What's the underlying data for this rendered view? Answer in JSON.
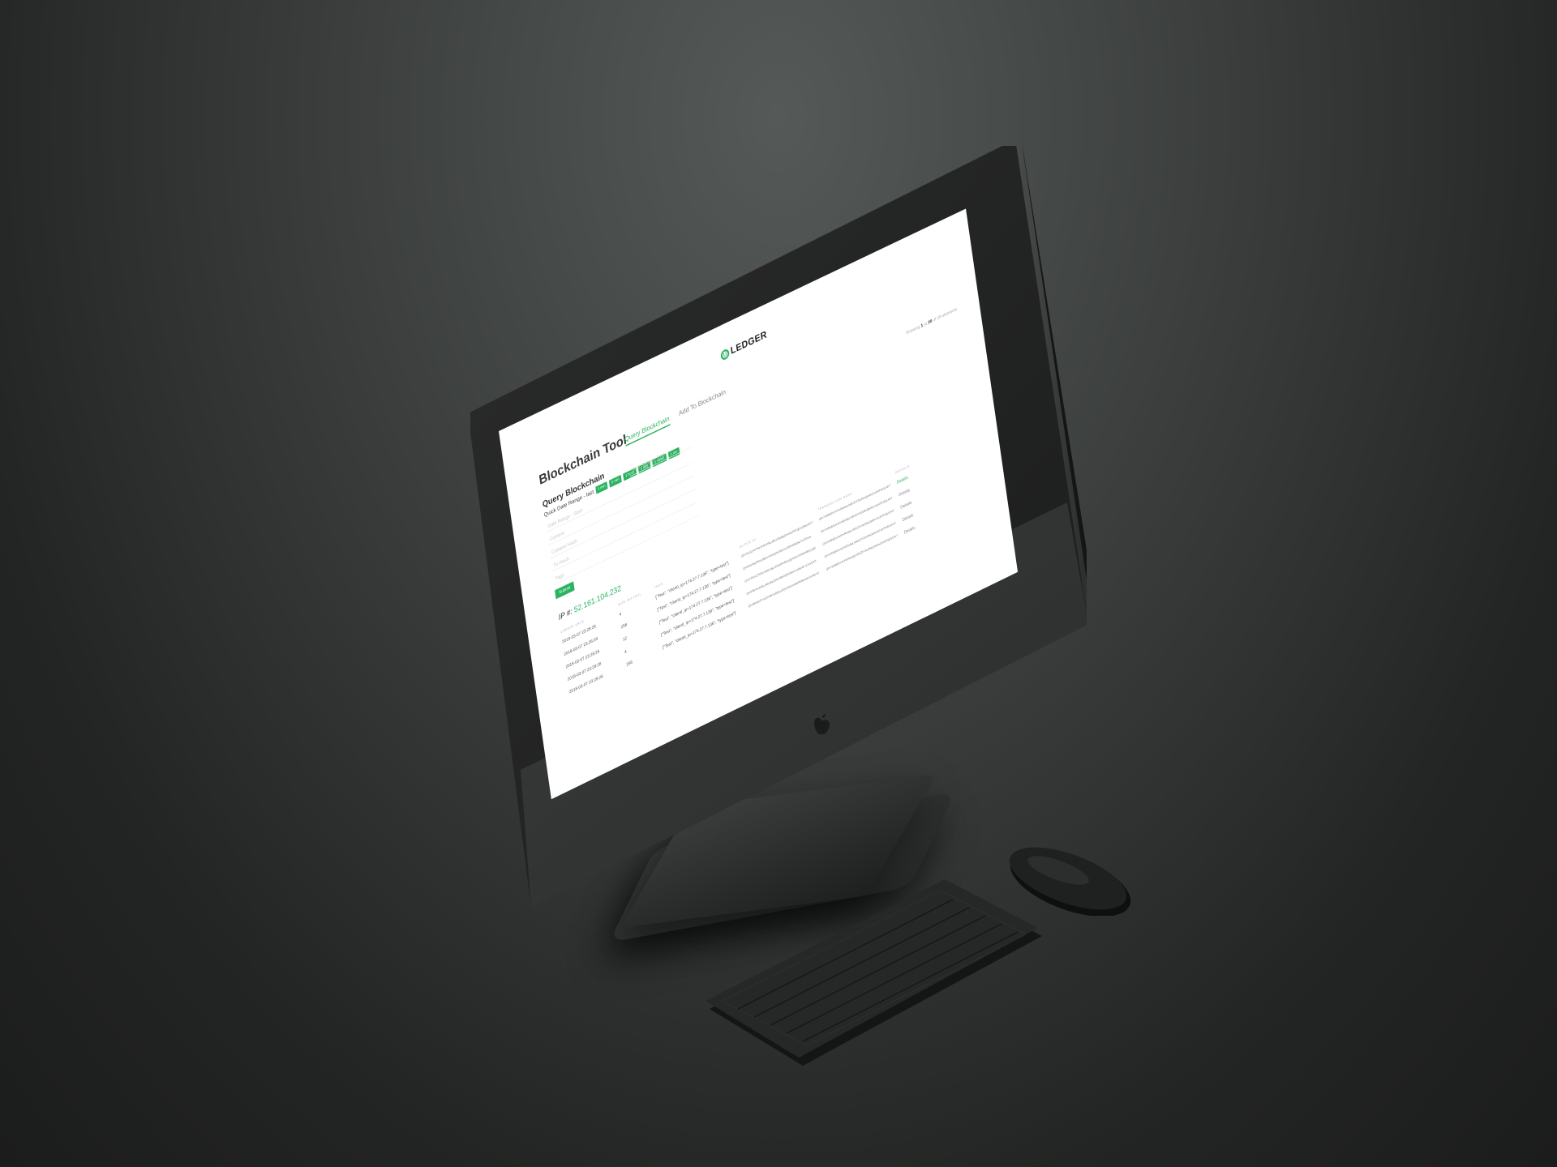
{
  "header": {
    "logo_mark": "U",
    "logo_text": "LEDGER"
  },
  "page": {
    "title": "Blockchain Tool",
    "tabs": [
      {
        "label": "Query Blockchain",
        "active": true
      },
      {
        "label": "Add To Blockchain",
        "active": false
      }
    ]
  },
  "query": {
    "section_title": "Query Blockchain",
    "quick_range_label": "Quick Date Range - last",
    "chips": [
      "1 min",
      "5 min",
      "1 hour",
      "1 day",
      "1 week",
      "1 mo"
    ],
    "fields": {
      "date_start": "Date Range - Start",
      "date_end": "Date Range - End",
      "content": "Content",
      "content_hash": "Content Hash",
      "tx_hash": "Tx Hash",
      "tags": "Tags"
    },
    "submit_label": "Submit"
  },
  "ip": {
    "label": "IP #: ",
    "value": "52.161.104.232"
  },
  "results": {
    "showing_prefix": "Showing ",
    "showing_from": "1",
    "showing_to_sep": " to ",
    "showing_to": "20",
    "showing_suffix": " of 28 elements",
    "columns": [
      "CREATE DATE",
      "SIZE (BYTES)",
      "TAGS",
      "BLOCK ID",
      "TRANSACTION HASH",
      "DETAILS"
    ],
    "rows": [
      {
        "date": "2018-03-07 23:28:26",
        "size": "4",
        "tags": "[\"Test\", \"clientI_ip=174.27.7.136\", \"type=test\"]",
        "block": "QmYkL9zXhT6e2nNvWkLaRcU3pBqDmS4oFhGjE1tZ8aVbY7",
        "hash": "Qm7eNkB2uVxFmRw6pLh8GZtY3cD9sQaWnJ1oKiPxEyU4rT",
        "details": "Details"
      },
      {
        "date": "2018-03-07 23:28:26",
        "size": "256",
        "tags": "[\"Test\", \"clientI_ip=174.27.7.136\", \"type=test\"]",
        "block": "QmR4aWqP8nLdBt2vXhK6jZsE9yGcUf3oMiNp5eTr1lYbVk",
        "hash": "Qm7eNkB2uVxFmRw6pLh8GZtY3cD9sQaWnJ1oKiPxEyU4rT",
        "details": "Details"
      },
      {
        "date": "2018-03-07 23:28:26",
        "size": "12",
        "tags": "[\"Test\", \"clientI_ip=174.27.7.136\", \"type=test\"]",
        "block": "QmT2hVcZ7bNrXk9pYqLwF4sDmE6uJgA3oK1iRtWn8eCyB5",
        "hash": "Qm7eNkB2uVxFmRw6pLh8GZtY3cD9sQaWnJ1oKiPxEyU4rT",
        "details": "Details"
      },
      {
        "date": "2018-03-07 23:28:26",
        "size": "4",
        "tags": "[\"Test\", \"clientI_ip=174.27.7.136\", \"type=test\"]",
        "block": "QmP9kXwR3tLyN6vBz2jHcU8sFqE5dGm1oAiK4nTr7eVbY0",
        "hash": "Qm7eNkB2uVxFmRw6pLh8GZtY3cD9sQaWnJ1oKiPxEyU4rT",
        "details": "Details"
      },
      {
        "date": "2018-03-07 23:28:26",
        "size": "256",
        "tags": "[\"Test\", \"clientI_ip=174.27.7.136\", \"type=test\"]",
        "block": "QmN6sQdT1wZrV8kXyB3jLcE5uFhG2oMaP9iR4nKt7eWbY3",
        "hash": "Qm7eNkB2uVxFmRw6pLh8GZtY3cD9sQaWnJ1oKiPxEyU4rT",
        "details": "Details"
      }
    ]
  },
  "colors": {
    "accent": "#2bb35f",
    "background": "#2a2c2c",
    "screen": "#ffffff"
  },
  "icons": {
    "logo": "uledger-logo-icon",
    "device_mark": "apple-icon"
  }
}
